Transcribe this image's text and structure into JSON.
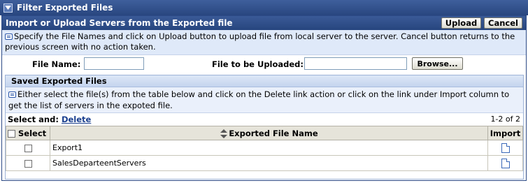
{
  "title_bar": {
    "label": "Filter Exported Files"
  },
  "panel": {
    "title": "Import or Upload Servers from the Exported file",
    "upload_label": "Upload",
    "cancel_label": "Cancel",
    "info_text": "Specify the File Names and click on Upload button to upload file from local server to the server. Cancel button returns to the previous screen with no action taken."
  },
  "form": {
    "file_name_label": "File Name:",
    "file_name_value": "",
    "upload_file_label": "File to be Uploaded:",
    "upload_file_value": "",
    "browse_label": "Browse..."
  },
  "saved": {
    "title": "Saved Exported Files",
    "info_text": "Either select the file(s) from the table below and click on the Delete link action or click on the link under Import column to get the list of servers in the expoted file.",
    "select_and_label": "Select and:",
    "delete_label": "Delete",
    "pager": "1-2 of 2",
    "columns": {
      "select": "Select",
      "name": "Exported File Name",
      "import": "Import"
    },
    "rows": [
      {
        "name": "Export1"
      },
      {
        "name": "SalesDeparteentServers"
      }
    ]
  }
}
